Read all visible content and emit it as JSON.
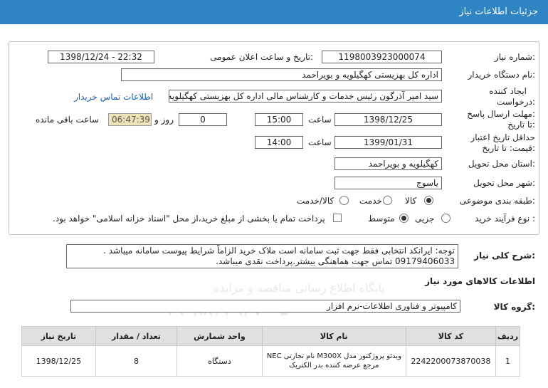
{
  "header": {
    "title": "جزئیات اطلاعات نیاز"
  },
  "form": {
    "need_number_label": "شماره نیاز:",
    "need_number": "1198003923000074",
    "announce_label": "تاریخ و ساعت اعلان عمومی:",
    "announce_value": "1398/12/24 - 22:32",
    "buyer_org_label": "نام دستگاه خریدار:",
    "buyer_org": "اداره کل بهزیستی کهگیلویه و بویراحمد",
    "creator_label_1": "ایجاد کننده",
    "creator_label_2": "درخواست:",
    "creator": "سید امیر آذرگون رئیس خدمات و کارشناس مالی اداره کل بهزیستی کهگیلویه و",
    "contact_link": "اطلاعات تماس خریدار",
    "reply_label_1": "مهلت ارسال پاسخ:",
    "reply_label_2": "تا تاریخ:",
    "reply_date": "1398/12/25",
    "time_label": "ساعت",
    "reply_time": "15:00",
    "days_value": "0",
    "days_label": "روز و",
    "remaining_time": "06:47:39",
    "remaining_label": "ساعت باقی مانده",
    "validity_label_1": "حداقل تاریخ اعتبار",
    "validity_label_2": "قیمت: تا تاریخ:",
    "validity_date": "1399/01/31",
    "validity_time": "14:00",
    "province_label": "استان محل تحویل:",
    "province": "کهگیلویه و بویراحمد",
    "city_label": "شهر محل تحویل:",
    "city": "یاسوج",
    "category_label": "طبقه بندی موضوعی:",
    "category_options": [
      "کالا",
      "خدمت",
      "کالا/خدمت"
    ],
    "process_label": "نوع فرآیند خرید :",
    "process_options": [
      "جزیی",
      "متوسط"
    ],
    "payment_note": "پرداخت تمام یا بخشی از مبلغ خرید،از محل \"اسناد خزانه اسلامی\" خواهد بود."
  },
  "description": {
    "label": "شرح کلی نیاز:",
    "line1": "توجه: ایرانکد انتخابی فقط جهت ثبت سامانه است ملاک خرید الزاماً شرایط پیوست سامانه میباشد .",
    "line2": "09179406033 تماس جهت هماهنگی بیشتر.پرداخت نقدی میباشد."
  },
  "goods": {
    "section_title": "اطلاعات کالاهای مورد نیاز",
    "group_label": "گروه کالا:",
    "group_value": "کامپیوتر و فناوری اطلاعات-نرم افزار",
    "columns": [
      "ردیف",
      "کد کالا",
      "نام کالا",
      "واحد شمارش",
      "تعداد / مقدار",
      "تاریخ نیاز"
    ],
    "rows": [
      {
        "row": "1",
        "code": "2242200073870038",
        "name": "ویدئو پروژکتور مدل M300X نام تجارتی NEC مرجع عرضه کننده بدر الکتریک",
        "unit": "دستگاه",
        "qty": "8",
        "date": "1398/12/25"
      }
    ]
  },
  "watermark": {
    "line1": "پایگاه اطلاع رسانی مناقصه و مزایده",
    "line2": "۰۲۱-۸۸۳۴۹۶۷۰-۵"
  }
}
